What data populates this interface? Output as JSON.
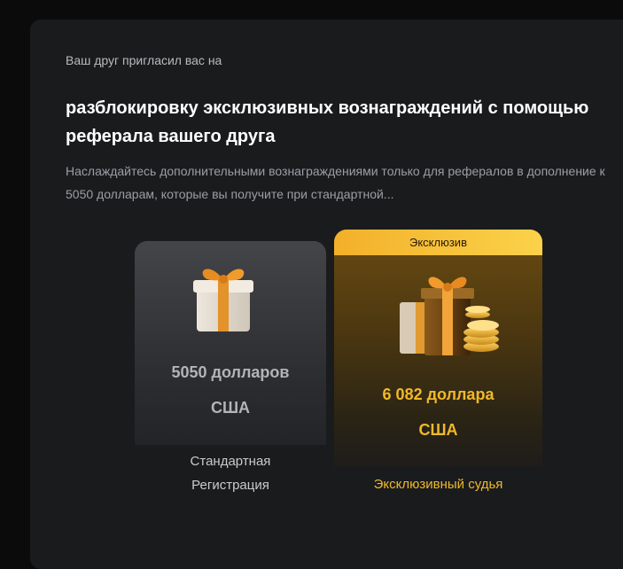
{
  "invite": {
    "subtitle": "Ваш друг пригласил вас на",
    "title": "разблокировку эксклюзивных вознаграждений с помощью реферала вашего друга",
    "description": "Наслаждайтесь дополнительными вознаграждениями только для рефералов в дополнение к 5050 долларам, которые вы получите при стандартной..."
  },
  "tiers": {
    "standard": {
      "amount_line1": "5050 долларов",
      "amount_line2": "США",
      "label_line1": "Стандартная",
      "label_line2": "Регистрация",
      "icon": "gift-box-icon"
    },
    "exclusive": {
      "badge": "Эксклюзив",
      "amount_line1": "6 082 доллара",
      "amount_line2": "США",
      "label": "Эксклюзивный судья",
      "icon": "gift-with-coins-icon"
    }
  },
  "colors": {
    "accent": "#f0b92a",
    "card_background": "#1a1b1d"
  }
}
